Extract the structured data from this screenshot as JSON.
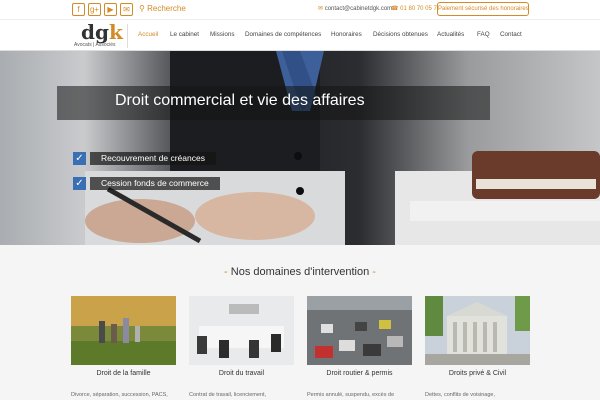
{
  "topbar": {
    "social_icons": [
      "facebook-icon",
      "google-plus-icon",
      "youtube-icon",
      "mail-icon"
    ],
    "social_glyphs": [
      "f",
      "g+",
      "▶",
      "✉"
    ],
    "search_label": "Recherche",
    "contact_email": "contact@cabinetdgk.com",
    "contact_phone": "01 80 70 05 70",
    "fees_button": "Paiement sécurisé des honoraires"
  },
  "logo": {
    "mark_d": "dg",
    "mark_k": "k",
    "subtitle": "Avocats | Associés"
  },
  "nav": {
    "items": [
      {
        "label": "Accueil",
        "active": true
      },
      {
        "label": "Le cabinet"
      },
      {
        "label": "Missions"
      },
      {
        "label": "Domaines de compétences"
      },
      {
        "label": "Honoraires"
      },
      {
        "label": "Décisions obtenues"
      },
      {
        "label": "Actualités"
      },
      {
        "label": "FAQ"
      },
      {
        "label": "Contact"
      }
    ]
  },
  "hero": {
    "title": "Droit commercial et vie des affaires",
    "bullets": [
      "Recouvrement de créances",
      "Cession fonds de commerce"
    ]
  },
  "domains": {
    "title": "Nos domaines d'intervention",
    "title_prefix": "-",
    "title_suffix": "-",
    "cards": [
      {
        "title": "Droit de la famille",
        "text": "Divorce, séparation, succession, PACS,"
      },
      {
        "title": "Droit du travail",
        "text": "Contrat de travail, licenciement,"
      },
      {
        "title": "Droit routier & permis",
        "text": "Permis annulé, suspendu, excès de"
      },
      {
        "title": "Droits privé & Civil",
        "text": "Dettes, conflits de voisinage,"
      }
    ]
  },
  "colors": {
    "accent": "#d48a26",
    "check": "#3a6fb3"
  }
}
